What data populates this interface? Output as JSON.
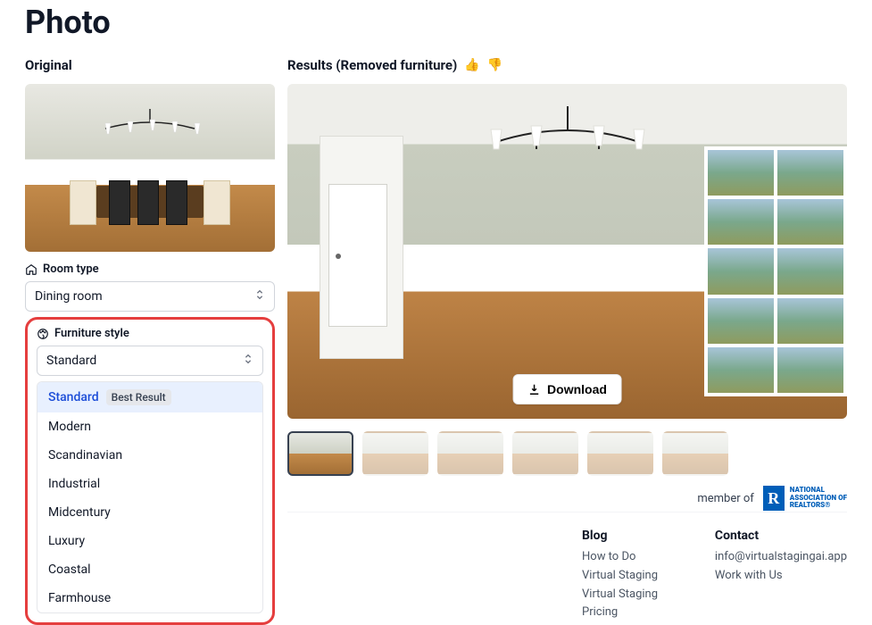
{
  "page": {
    "title": "Photo"
  },
  "original": {
    "label": "Original"
  },
  "results": {
    "label": "Results (Removed furniture)",
    "download_label": "Download"
  },
  "room_type": {
    "label": "Room type",
    "value": "Dining room"
  },
  "furniture_style": {
    "label": "Furniture style",
    "value": "Standard",
    "best_badge": "Best Result",
    "options": [
      "Standard",
      "Modern",
      "Scandinavian",
      "Industrial",
      "Midcentury",
      "Luxury",
      "Coastal",
      "Farmhouse"
    ]
  },
  "footer": {
    "member_of": "member of",
    "realtor_line1": "NATIONAL",
    "realtor_line2": "ASSOCIATION OF",
    "realtor_line3": "REALTORS®",
    "blog": {
      "title": "Blog",
      "link1": "How to Do Virtual Staging",
      "link2": "Virtual Staging Pricing"
    },
    "contact": {
      "title": "Contact",
      "email": "info@virtualstagingai.app",
      "work_with": "Work with Us"
    }
  }
}
